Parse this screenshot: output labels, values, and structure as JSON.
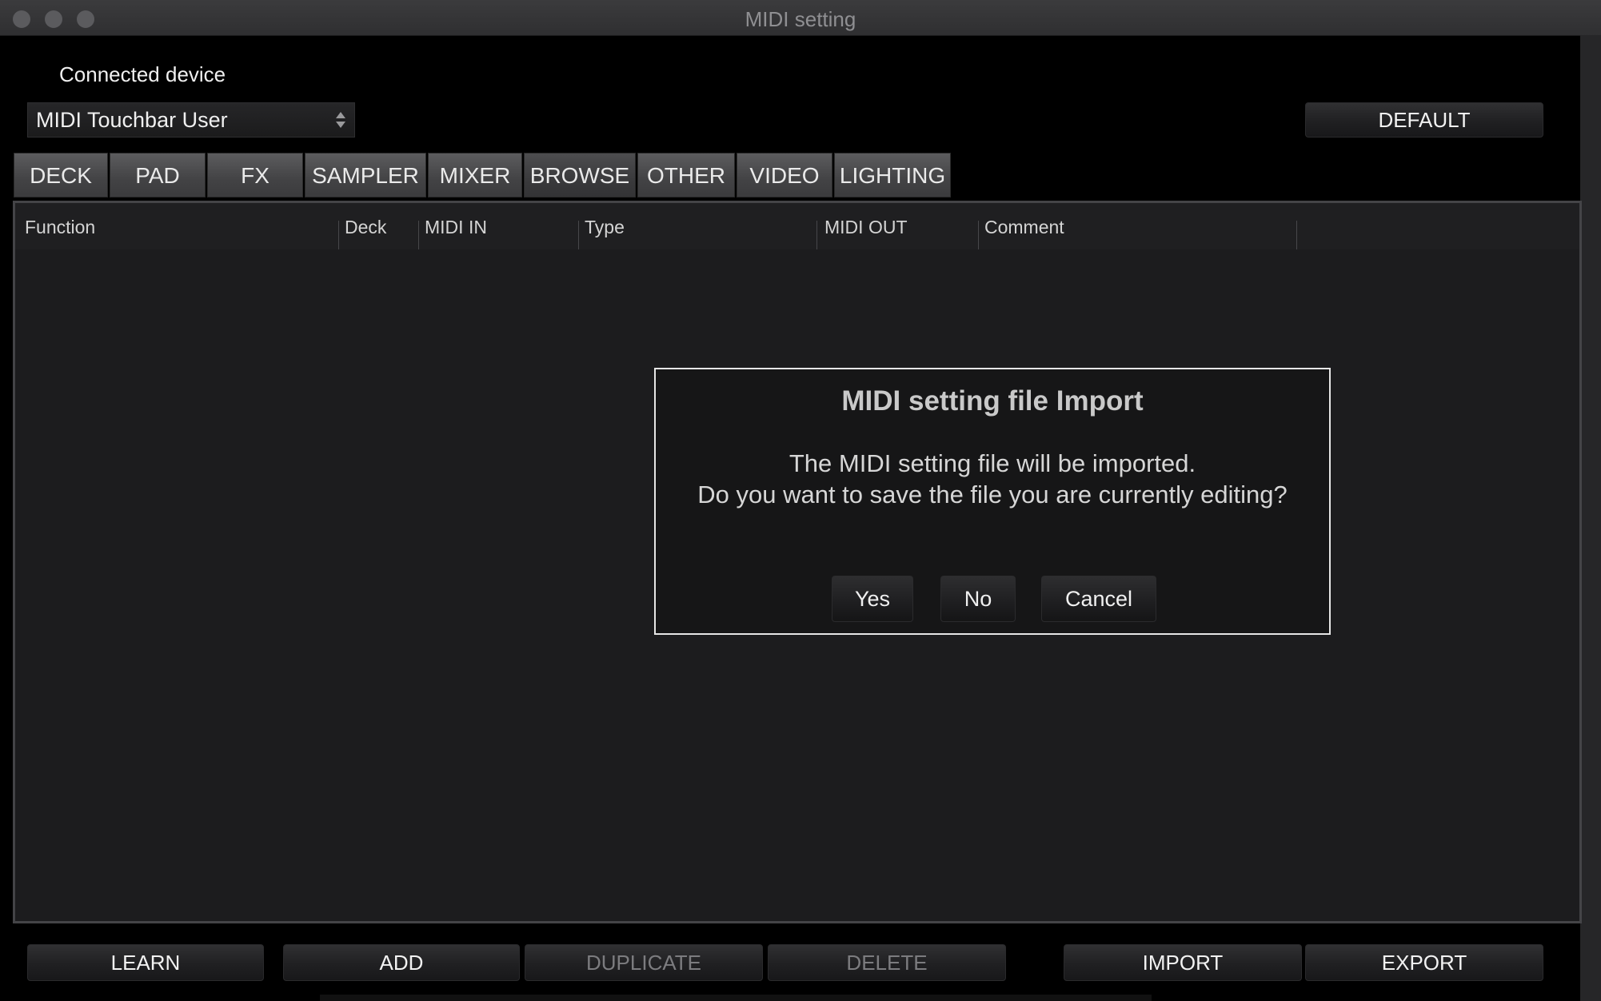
{
  "window": {
    "title": "MIDI setting"
  },
  "header": {
    "connected_label": "Connected device",
    "device": "MIDI Touchbar User",
    "default_label": "DEFAULT"
  },
  "tabs": [
    "DECK",
    "PAD",
    "FX",
    "SAMPLER",
    "MIXER",
    "BROWSE",
    "OTHER",
    "VIDEO",
    "LIGHTING"
  ],
  "active_tab": "BROWSE",
  "table": {
    "columns": [
      "Function",
      "Deck",
      "MIDI IN",
      "Type",
      "MIDI OUT",
      "Comment"
    ],
    "rows": []
  },
  "dialog": {
    "title": "MIDI setting file Import",
    "message_line1": "The MIDI setting file will be imported.",
    "message_line2": "Do you want to save the file you are currently editing?",
    "yes": "Yes",
    "no": "No",
    "cancel": "Cancel"
  },
  "toolbar": {
    "learn": "LEARN",
    "add": "ADD",
    "duplicate": "DUPLICATE",
    "delete": "DELETE",
    "import": "IMPORT",
    "export": "EXPORT"
  },
  "colors": {
    "background": "#000000",
    "panel": "#1c1c1e",
    "dialog_border": "#e6e6e6",
    "disabled_text": "#7c7c7f"
  }
}
